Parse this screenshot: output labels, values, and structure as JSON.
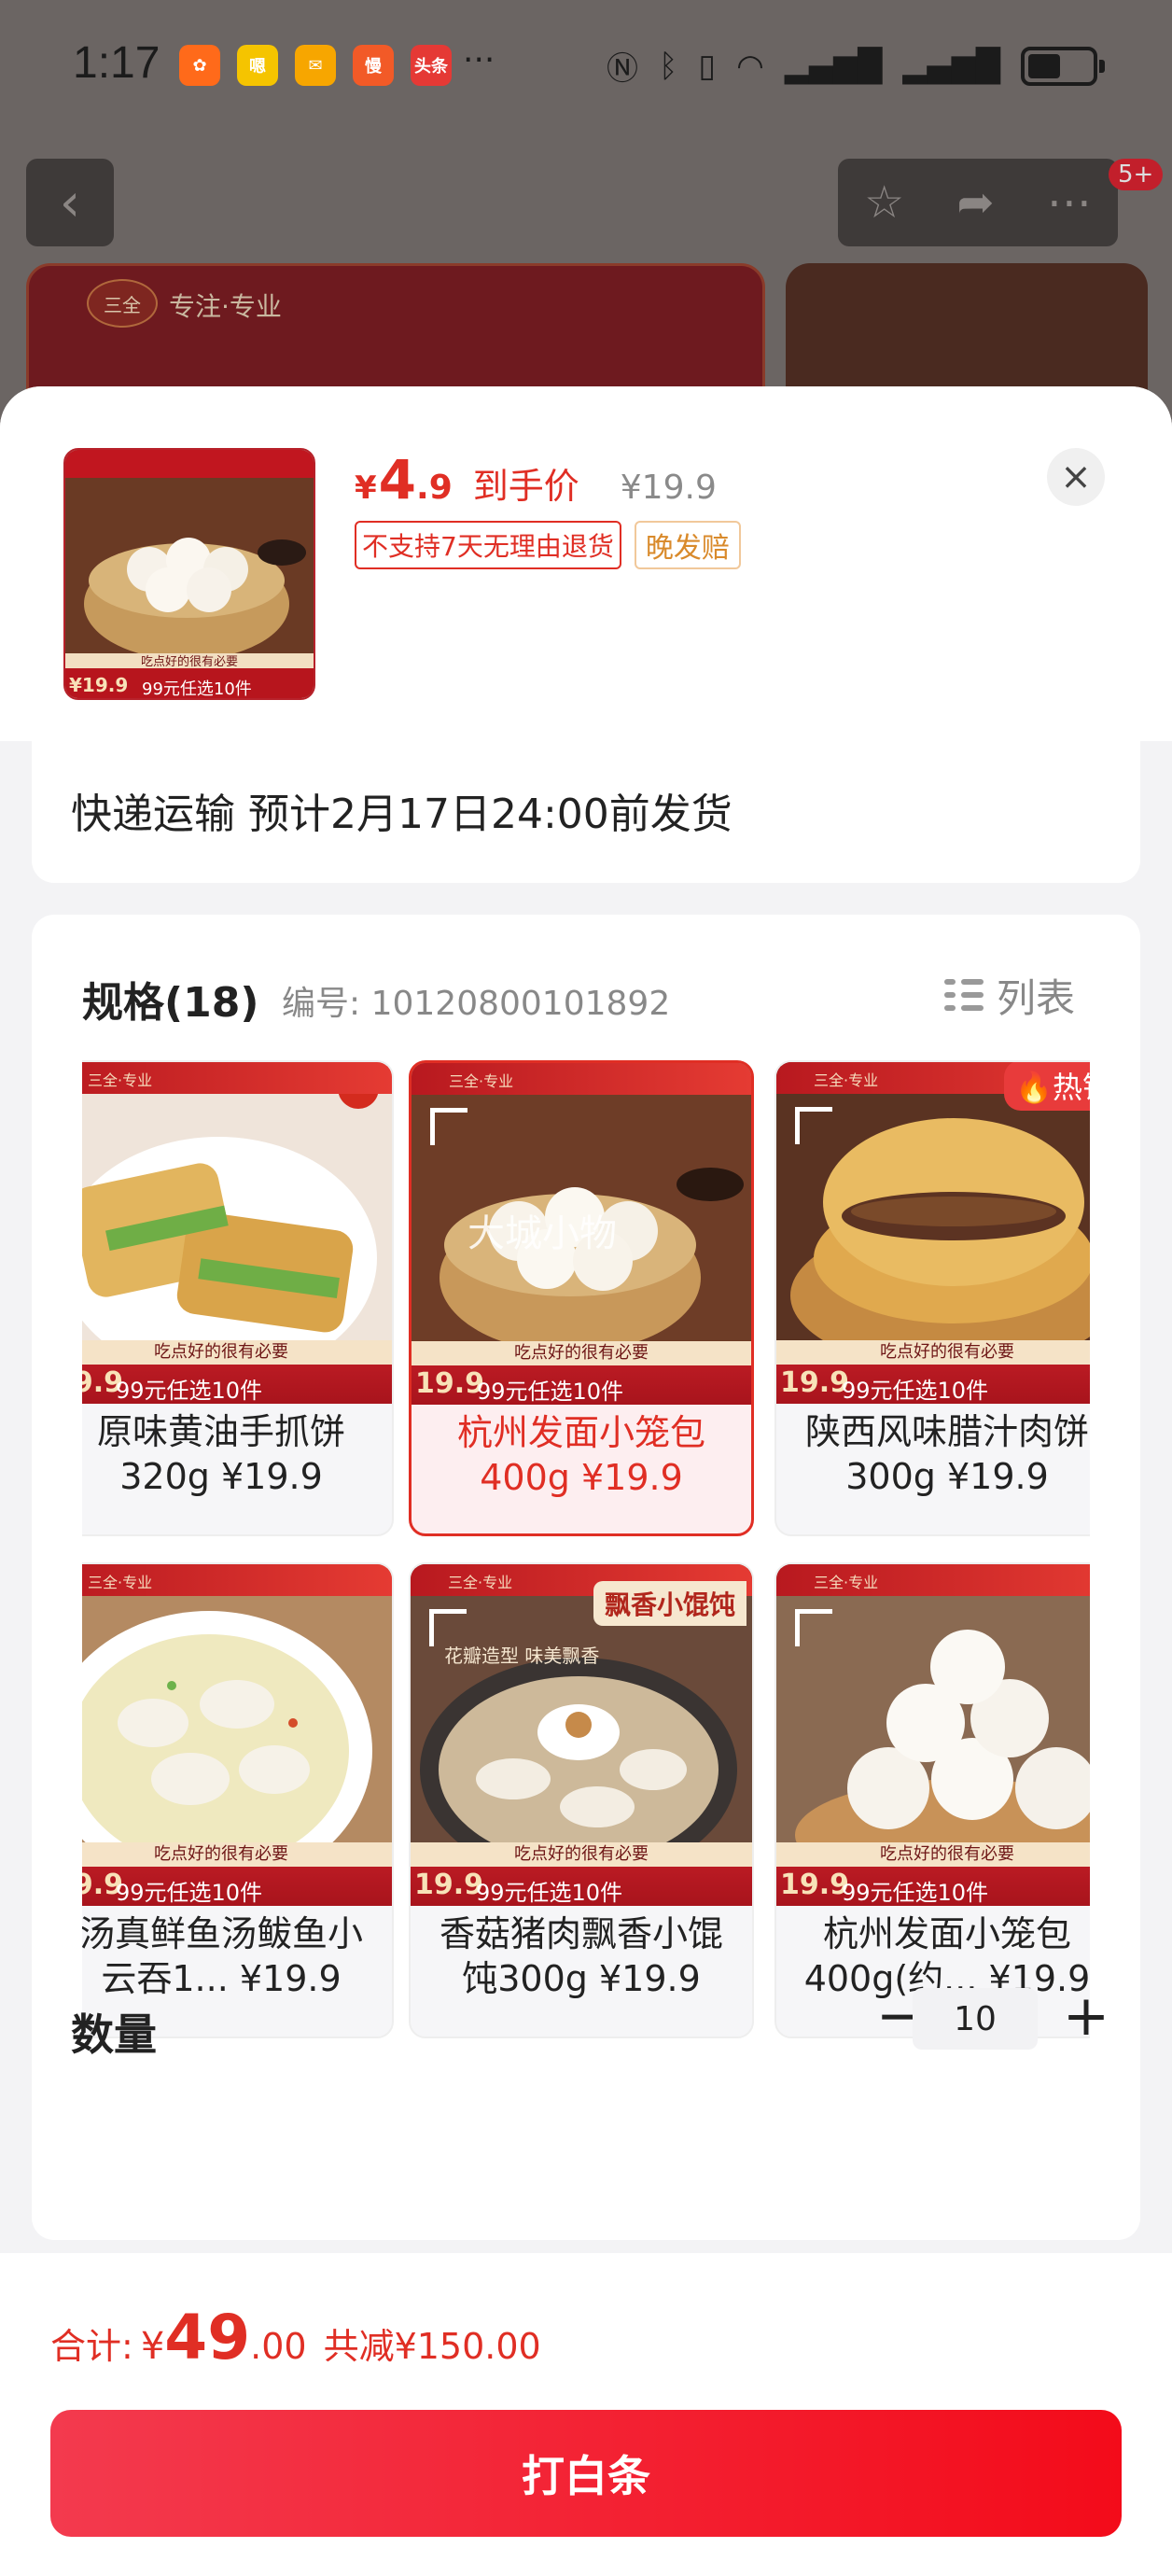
{
  "status": {
    "time": "1:17",
    "app_icons": [
      {
        "name": "app-icon-flower",
        "glyph": "✿",
        "color": "#ff6a1a"
      },
      {
        "name": "app-icon-cartoon",
        "glyph": "嗯",
        "color": "#f5c400"
      },
      {
        "name": "app-icon-mail",
        "glyph": "✉",
        "color": "#f7a600"
      },
      {
        "name": "app-icon-slow",
        "glyph": "慢",
        "color": "#f25a27"
      },
      {
        "name": "app-icon-toutiao",
        "glyph": "头条",
        "color": "#e53935"
      }
    ],
    "more": "···",
    "notification_count": "5+"
  },
  "background_page": {
    "brand_tagline": "专注·专业",
    "brand_logo": "三全"
  },
  "product": {
    "price_currency": "¥",
    "price_int": "4",
    "price_dec": ".9",
    "price_label": "到手价",
    "original_price": "¥19.9",
    "tag_no_return": "不支持7天无理由退货",
    "tag_late": "晚发赔",
    "thumb_banner_top": "吃点好的很有必要",
    "thumb_banner_price": "¥19.9",
    "thumb_banner_text": "99元任选10件"
  },
  "shipping": {
    "text": "快递运输 预计2月17日24:00前发货"
  },
  "spec": {
    "title": "规格(18)",
    "code": "编号: 10120800101892",
    "list_label": "列表",
    "hot_badge": "热销",
    "watermark": "大城小物",
    "banner_top": "吃点好的很有必要",
    "banner_offer": "99元任选10件",
    "banner_price": "19.9",
    "card_brand": "三全·专业",
    "items": [
      {
        "name_line1": "原味黄油手抓饼",
        "name_line2": "320g ¥19.9",
        "selected": false
      },
      {
        "name_line1": "杭州发面小笼包",
        "name_line2": "400g ¥19.9",
        "selected": true
      },
      {
        "name_line1": "陕西风味腊汁肉饼",
        "name_line2": "300g ¥19.9",
        "selected": false
      },
      {
        "name_line1": "汤真鲜鱼汤鲅鱼小",
        "name_line2": "云吞1... ¥19.9",
        "selected": false
      },
      {
        "name_line1": "香菇猪肉飘香小馄",
        "name_line2": "饨300g ¥19.9",
        "selected": false
      },
      {
        "name_line1": "杭州发面小笼包",
        "name_line2": "400g(约... ¥19.9",
        "selected": false
      }
    ],
    "wonton_tag": "飘香小馄饨",
    "wonton_sub": "花瓣造型 味美飘香"
  },
  "quantity": {
    "label": "数量",
    "value": "10",
    "minus": "−",
    "plus": "+"
  },
  "footer": {
    "total_label": "合计:",
    "total_yen": "¥",
    "total_int": "49",
    "total_dec": ".00",
    "saving": "共减¥150.00",
    "pay_button": "打白条"
  },
  "colors": {
    "accent": "#e02e24",
    "button_gradient_start": "#f33a4e",
    "button_gradient_end": "#f30b1a"
  }
}
